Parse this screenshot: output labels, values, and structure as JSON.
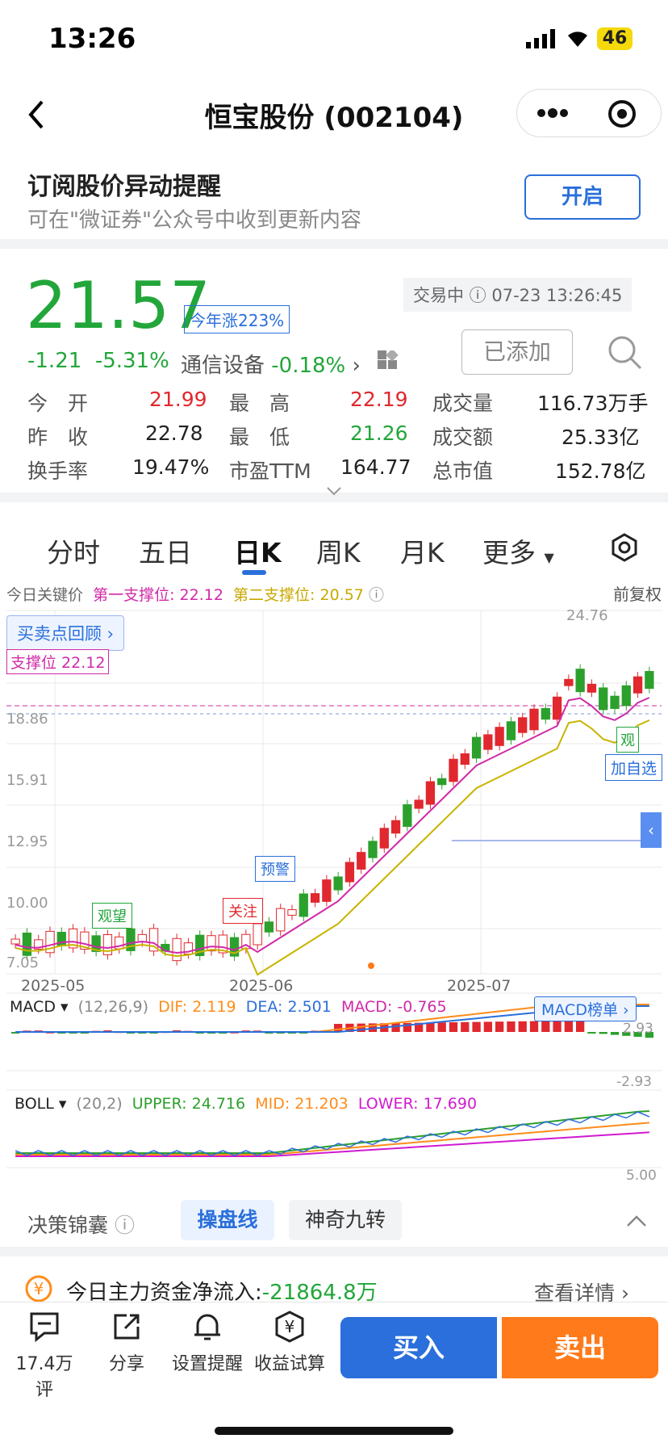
{
  "status": {
    "time": "13:26",
    "battery": "46"
  },
  "nav": {
    "title": "恒宝股份 (002104)"
  },
  "subscribe": {
    "title": "订阅股价异动提醒",
    "desc": "可在\"微证券\"公众号中收到更新内容",
    "button": "开启"
  },
  "quote": {
    "price": "21.57",
    "ytd": "今年涨223%",
    "change": "-1.21",
    "pct": "-5.31%",
    "sector": "通信设备",
    "sector_pct": "-0.18%",
    "status": "交易中",
    "datetime": "07-23 13:26:45",
    "added": "已添加",
    "r1": [
      "今　开",
      "21.99",
      "最　高",
      "22.19",
      "成交量",
      "116.73万手"
    ],
    "r2": [
      "昨　收",
      "22.78",
      "最　低",
      "21.26",
      "成交额",
      "25.33亿"
    ],
    "r3": [
      "换手率",
      "19.47%",
      "市盈TTM",
      "164.77",
      "总市值",
      "152.78亿"
    ]
  },
  "tabs": [
    "分时",
    "五日",
    "日K",
    "周K",
    "月K",
    "更多"
  ],
  "chart": {
    "keyprice": "今日关键价",
    "s1": "第一支撑位: 22.12",
    "s2": "第二支撑位: 20.57",
    "adj": "前复权",
    "review": "买卖点回顾",
    "support": "支撑位 22.12",
    "yticks": [
      "24.76",
      "18.86",
      "15.91",
      "12.95",
      "10.00",
      "7.05"
    ],
    "dates": [
      "2025-05",
      "2025-06",
      "2025-07"
    ],
    "tags": {
      "watch": "观望",
      "focus": "关注",
      "alert": "预警",
      "watch2": "观",
      "add": "加自选"
    },
    "macd": {
      "label": "MACD",
      "params": "(12,26,9)",
      "dif": "DIF: 2.119",
      "dea": "DEA: 2.501",
      "macd": "MACD: -0.765",
      "rank": "MACD榜单",
      "top": "2.93",
      "bottom": "-2.93"
    },
    "boll": {
      "label": "BOLL",
      "params": "(20,2)",
      "upper": "UPPER: 24.716",
      "mid": "MID: 21.203",
      "lower": "LOWER: 17.690",
      "low": "5.00"
    }
  },
  "tools": {
    "t1": "决策锦囊",
    "t2": "操盘线",
    "t3": "神奇九转"
  },
  "flow": {
    "label": "今日主力资金净流入:",
    "value": "-21864.8万",
    "detail": "查看详情"
  },
  "bottom": {
    "b1": "17.4万评",
    "b2": "分享",
    "b3": "设置提醒",
    "b4": "收益试算",
    "buy": "买入",
    "sell": "卖出"
  },
  "colors": {
    "up": "#e0282e",
    "down": "#2ca02c",
    "blue": "#1a73e8",
    "orange": "#ff7a1a"
  }
}
